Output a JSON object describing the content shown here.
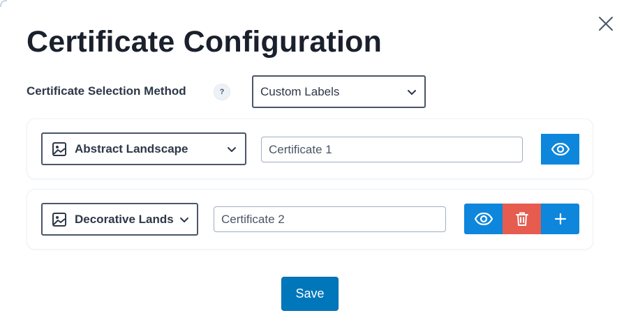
{
  "dialog": {
    "title": "Certificate Configuration",
    "close_icon": "close-icon"
  },
  "selection_method": {
    "label": "Certificate Selection Method",
    "help_text": "?",
    "selected": "Custom Labels"
  },
  "rows": [
    {
      "image_icon": "image-icon",
      "image_selected": "Abstract Landscape",
      "label_value": "Certificate 1",
      "actions": [
        "view"
      ]
    },
    {
      "image_icon": "image-icon",
      "image_selected": "Decorative Landscape",
      "label_value": "Certificate 2",
      "actions": [
        "view",
        "delete",
        "add"
      ]
    }
  ],
  "colors": {
    "primary": "#0e86dc",
    "danger": "#e65c4f",
    "save": "#0077bb",
    "title": "#1a202c"
  },
  "footer": {
    "save_label": "Save"
  }
}
